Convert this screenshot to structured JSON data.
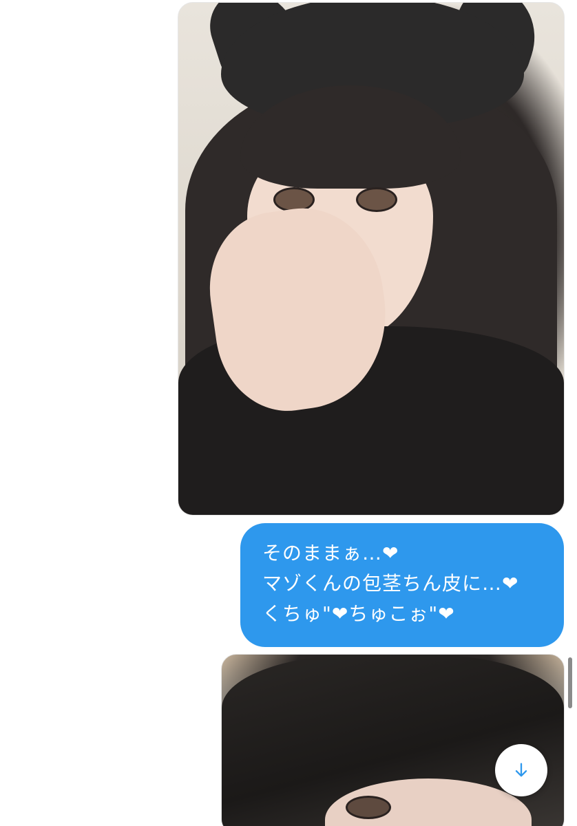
{
  "conversation": {
    "messages": [
      {
        "type": "image"
      },
      {
        "type": "text",
        "lines": [
          "そのままぁ…❤",
          "マゾくんの包茎ちん皮に…❤",
          "くちゅ\"❤ちゅこぉ\"❤"
        ]
      },
      {
        "type": "image"
      }
    ]
  },
  "colors": {
    "sent_bubble": "#2e98ed",
    "scroll_arrow": "#2e98ed",
    "background": "#ffffff"
  },
  "icons": {
    "scroll_down": "arrow-down-icon"
  }
}
